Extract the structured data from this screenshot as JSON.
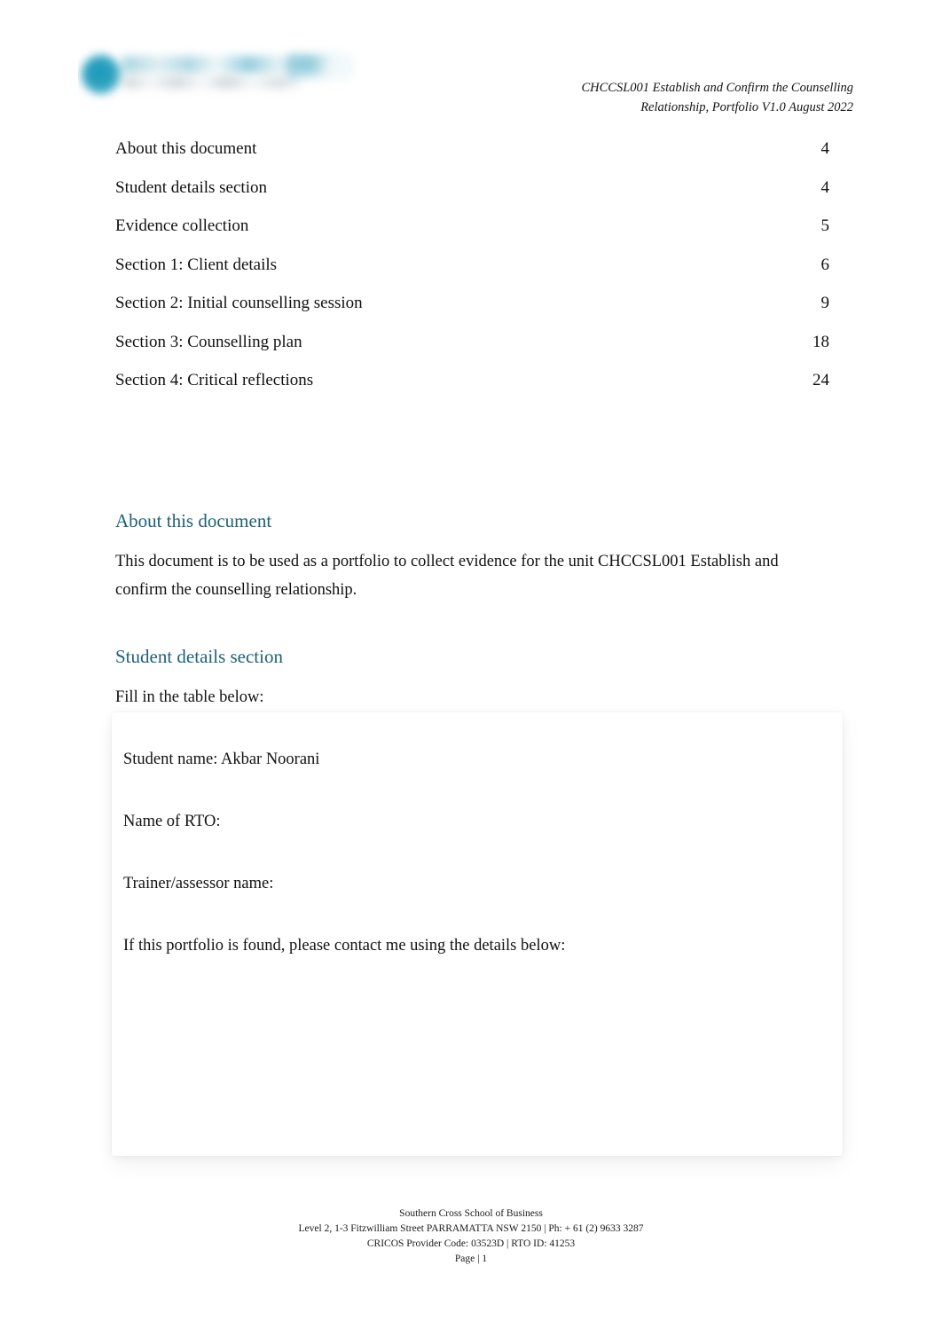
{
  "header": {
    "logo_alt": "Southern Cross School of Business logo",
    "document_reference_line1": "CHCCSL001 Establish and Confirm the Counselling",
    "document_reference_line2": "Relationship, Portfolio V1.0 August 2022"
  },
  "toc": {
    "entries": [
      {
        "title": "About this document",
        "page": "4"
      },
      {
        "title": "Student details section",
        "page": "4"
      },
      {
        "title": "Evidence collection",
        "page": "5"
      },
      {
        "title": "Section 1: Client details",
        "page": "6"
      },
      {
        "title": "Section 2: Initial counselling session",
        "page": "9"
      },
      {
        "title": "Section 3: Counselling plan",
        "page": "18"
      },
      {
        "title": "Section 4: Critical reflections",
        "page": "24"
      }
    ]
  },
  "about_section": {
    "heading": "About this document",
    "paragraph": "This document is to be used as a portfolio to collect evidence for the unit CHCCSL001 Establish and confirm the counselling relationship."
  },
  "student_details_section": {
    "heading": "Student details section",
    "instruction": "Fill in the table below:",
    "fields": [
      {
        "label": "Student name: Akbar Noorani"
      },
      {
        "label": "Name of RTO:"
      },
      {
        "label": "Trainer/assessor name:"
      },
      {
        "label": "If this portfolio is found, please contact me using the details below:"
      }
    ]
  },
  "footer": {
    "organisation": "Southern Cross School of Business",
    "address": "Level 2, 1-3 Fitzwilliam Street PARRAMATTA NSW 2150 | Ph: + 61 (2) 9633 3287",
    "codes": "CRICOS Provider Code: 03523D | RTO ID: 41253",
    "page_label": "Page | 1"
  },
  "colors": {
    "heading_teal": "#1f6079",
    "logo_cyan": "#1896b8",
    "body_text": "#111111"
  }
}
